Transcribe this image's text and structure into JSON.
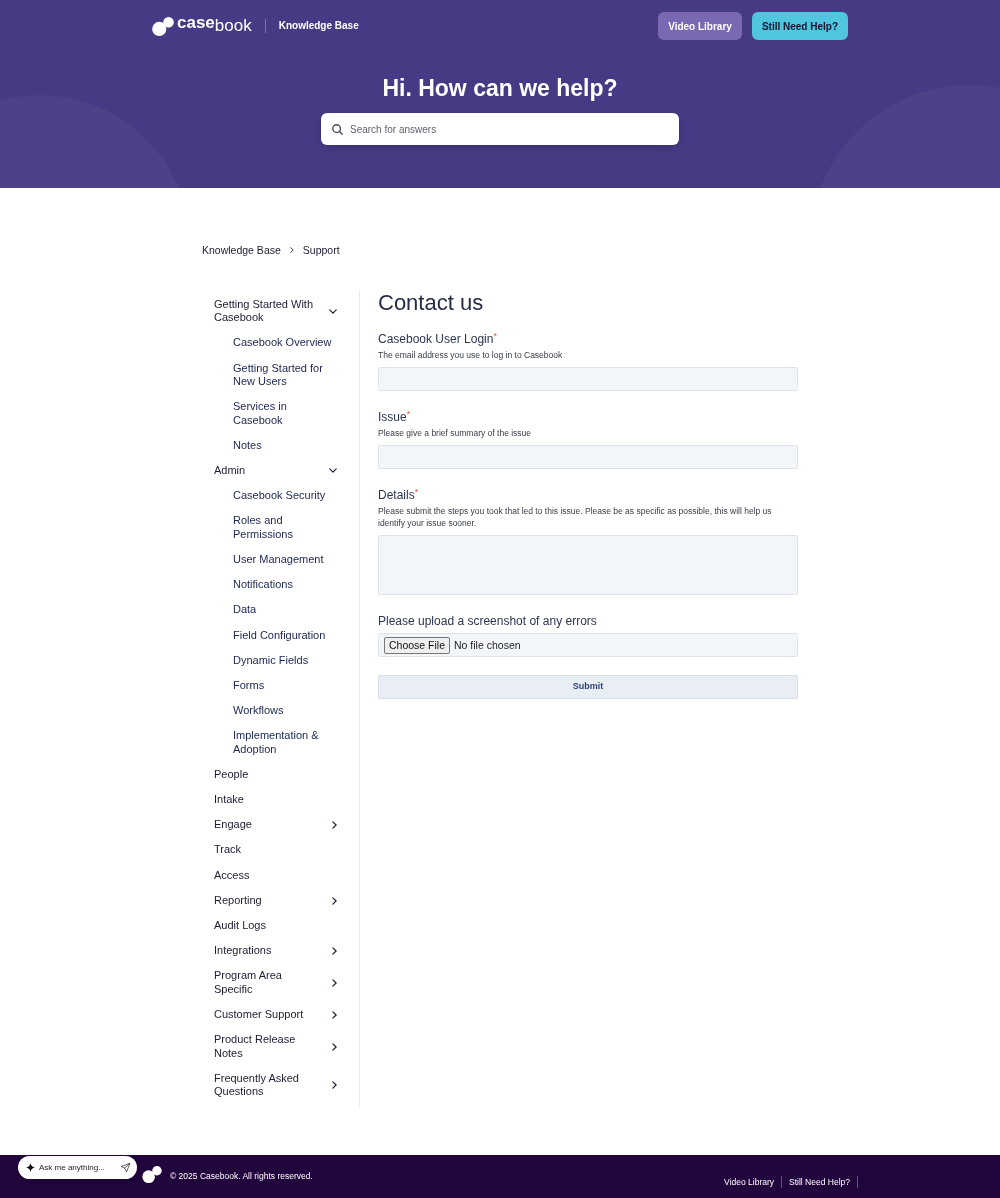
{
  "header": {
    "logo": "**case**book",
    "section": "Knowledge Base",
    "buttons": [
      {
        "label": "Video Library",
        "kind": "secondary"
      },
      {
        "label": "Still Need Help?",
        "kind": "primary"
      }
    ]
  },
  "hero": {
    "title": "Hi. How can we help?",
    "search": {
      "placeholder": "Search for answers"
    }
  },
  "breadcrumb": [
    {
      "label": "Knowledge Base"
    },
    {
      "label": "Support"
    }
  ],
  "sidebar": {
    "items": [
      {
        "label": "Getting Started With Casebook",
        "expanded": true,
        "children": [
          {
            "label": "Casebook Overview"
          },
          {
            "label": "Getting Started for New Users"
          },
          {
            "label": "Services in Casebook"
          },
          {
            "label": "Notes"
          }
        ]
      },
      {
        "label": "Admin",
        "expanded": true,
        "children": [
          {
            "label": "Casebook Security"
          },
          {
            "label": "Roles and Permissions"
          },
          {
            "label": "User Management"
          },
          {
            "label": "Notifications"
          },
          {
            "label": "Data"
          },
          {
            "label": "Field Configuration"
          },
          {
            "label": "Dynamic Fields"
          },
          {
            "label": "Forms"
          },
          {
            "label": "Workflows"
          },
          {
            "label": "Implementation & Adoption"
          }
        ]
      },
      {
        "label": "People"
      },
      {
        "label": "Intake"
      },
      {
        "label": "Engage",
        "expanded": false
      },
      {
        "label": "Track"
      },
      {
        "label": "Access"
      },
      {
        "label": "Reporting",
        "expanded": false
      },
      {
        "label": "Audit Logs"
      },
      {
        "label": "Integrations",
        "expanded": false
      },
      {
        "label": "Program Area Specific",
        "expanded": false
      },
      {
        "label": "Customer Support",
        "expanded": false
      },
      {
        "label": "Product Release Notes",
        "expanded": false
      },
      {
        "label": "Frequently Asked Questions",
        "expanded": false
      }
    ]
  },
  "form": {
    "title": "Contact us",
    "required_mark": "*",
    "fields": [
      {
        "kind": "text",
        "label": "Casebook User Login",
        "required": true,
        "hint": "The email address you use to log in to Casebook"
      },
      {
        "kind": "text",
        "label": "Issue",
        "required": true,
        "hint": "Please give a brief summary of the issue"
      },
      {
        "kind": "textarea",
        "label": "Details",
        "required": true,
        "hint": "Please submit the steps you took that led to this issue. Please be as specific as possible, this will help us identify your issue sooner."
      },
      {
        "kind": "file",
        "label": "Please upload a screenshot of any errors",
        "required": false,
        "button": "Choose File",
        "status": "No file chosen"
      }
    ],
    "submit": "Submit"
  },
  "chat": {
    "placeholder": "Ask me anything..."
  },
  "footer": {
    "copyright": "© 2025 Casebook. All rights reserved.",
    "links": [
      "Video Library",
      "Still Need Help?"
    ]
  }
}
